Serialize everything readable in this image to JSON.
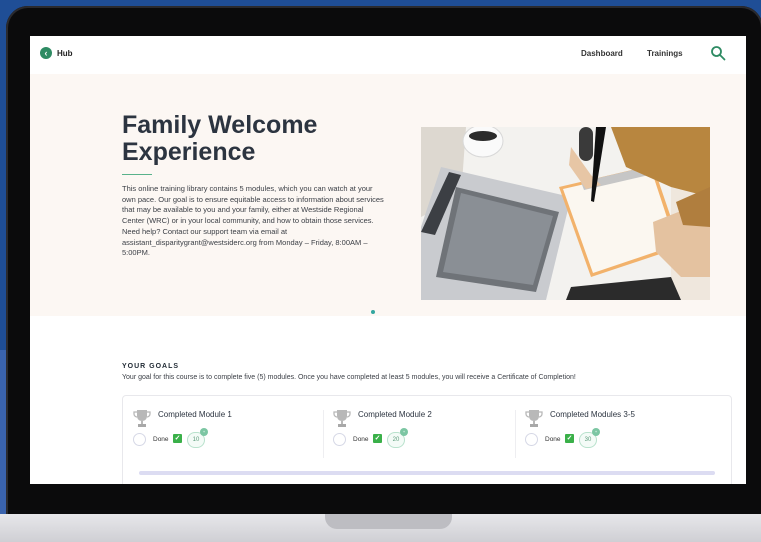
{
  "nav": {
    "hub_label": "Hub",
    "links": [
      "Dashboard",
      "Trainings"
    ]
  },
  "hero": {
    "title": "Family Welcome Experience",
    "description": "This online training library contains 5 modules, which you can watch at your own pace. Our goal is to ensure equitable access to information about services that may be available to you and your family, either at  Westside Regional Center (WRC)  or in your local community, and how to obtain those services. Need help? Contact our support team via email at assistant_disparitygrant@westsiderc.org from Monday – Friday, 8:00AM – 5:00PM."
  },
  "goals": {
    "heading": "YOUR GOALS",
    "text": "Your goal for this course is to complete  five (5)  modules. Once you have completed  at least 5  modules, you will receive a Certificate of Completion!",
    "items": [
      {
        "title": "Completed Module 1",
        "status": "Done",
        "points": "10"
      },
      {
        "title": "Completed Module 2",
        "status": "Done",
        "points": "20"
      },
      {
        "title": "Completed Modules 3-5",
        "status": "Done",
        "points": "30"
      }
    ]
  },
  "colors": {
    "accent": "#2e8b63",
    "check": "#3ab049",
    "hero_bg": "#fcf7f3",
    "progress_track": "#dcdcf2"
  },
  "icons": [
    "back-arrow-icon",
    "search-icon",
    "trophy-icon",
    "check-icon",
    "plus-icon"
  ]
}
